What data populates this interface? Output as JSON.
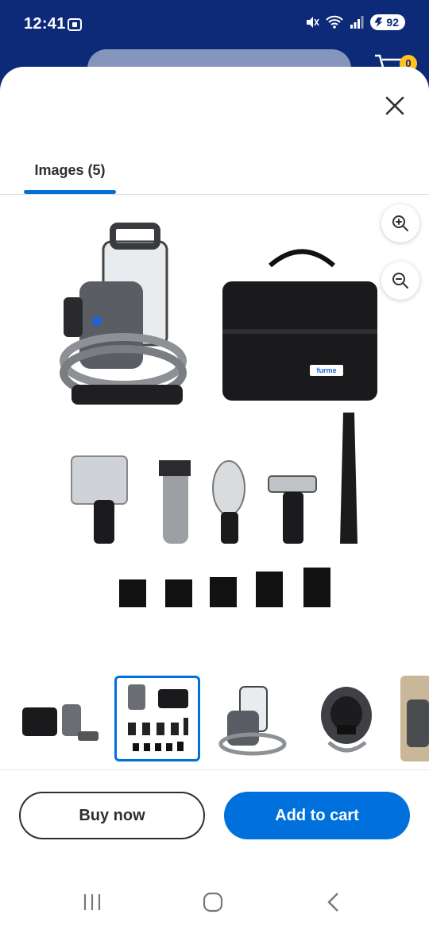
{
  "status_bar": {
    "time": "12:41",
    "battery": "92",
    "network": "5"
  },
  "background_header": {
    "cart_count": "0"
  },
  "modal": {
    "tab_label": "Images (5)",
    "close_icon": "close-icon",
    "zoom_in_icon": "zoom-in-icon",
    "zoom_out_icon": "zoom-out-icon",
    "product_brand_text": "furme",
    "selected_thumbnail_index": 1,
    "thumbnails": [
      {
        "name": "thumbnail-bundle-bag"
      },
      {
        "name": "thumbnail-all-accessories"
      },
      {
        "name": "thumbnail-vacuum-unit"
      },
      {
        "name": "thumbnail-top-view"
      },
      {
        "name": "thumbnail-in-use"
      }
    ]
  },
  "actions": {
    "buy_now_label": "Buy now",
    "add_to_cart_label": "Add to cart"
  },
  "navigation": {
    "recents_icon": "recent-apps-icon",
    "home_icon": "home-icon",
    "back_icon": "back-icon"
  },
  "colors": {
    "brand_blue": "#0071dc",
    "header_navy": "#0c2a78",
    "badge_yellow": "#ffc220"
  }
}
